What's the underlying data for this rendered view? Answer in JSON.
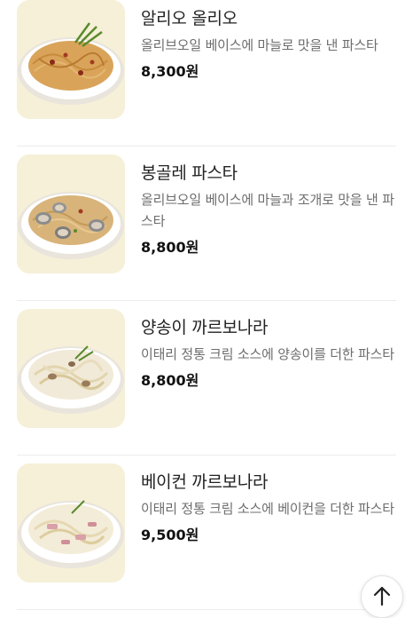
{
  "menu": {
    "items": [
      {
        "name": "알리오 올리오",
        "description": "올리브오일 베이스에 마늘로 맛을 낸 파스타",
        "price": "8,300원"
      },
      {
        "name": "봉골레 파스타",
        "description": "올리브오일 베이스에 마늘과 조개로 맛을 낸 파스타",
        "price": "8,800원"
      },
      {
        "name": "양송이 까르보나라",
        "description": "이태리 정통 크림 소스에 양송이를 더한 파스타",
        "price": "8,800원"
      },
      {
        "name": "베이컨 까르보나라",
        "description": "이태리 정통 크림 소스에 베이컨을 더한 파스타",
        "price": "9,500원"
      }
    ]
  },
  "scroll_top_icon": "arrow-up-icon",
  "colors": {
    "thumbnail_bg": "#f5f0d7",
    "price": "#111111",
    "description": "#6d6d6d"
  }
}
